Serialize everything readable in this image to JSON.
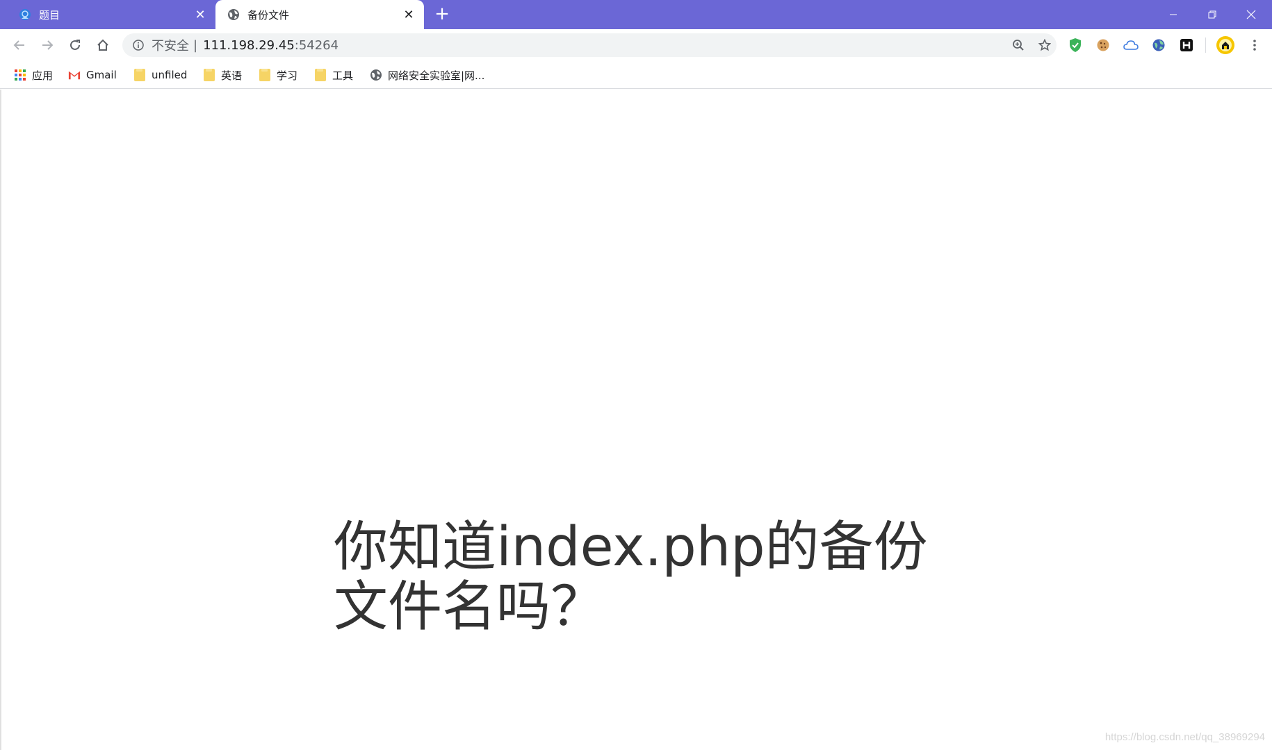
{
  "browser": {
    "tabs": [
      {
        "title": "题目",
        "active": false,
        "favicon": "site-logo-icon"
      },
      {
        "title": "备份文件",
        "active": true,
        "favicon": "globe-icon"
      }
    ],
    "new_tab_label": "+",
    "window_controls": [
      "minimize-icon",
      "restore-icon",
      "close-icon"
    ]
  },
  "toolbar": {
    "security_label": "不安全",
    "separator": "|",
    "url_host": "111.198.29.45",
    "url_port": ":54264",
    "icons": [
      "back-icon",
      "forward-icon",
      "reload-icon",
      "home-icon",
      "zoom-icon",
      "star-icon",
      "menu-icon"
    ],
    "extensions": [
      "shield-extension-icon",
      "cookie-extension-icon",
      "cloud-extension-icon",
      "globe-extension-icon",
      "h-extension-icon",
      "profile-avatar-icon"
    ]
  },
  "bookmarks": [
    {
      "label": "应用",
      "icon": "apps-grid-icon"
    },
    {
      "label": "Gmail",
      "icon": "gmail-icon"
    },
    {
      "label": "unfiled",
      "icon": "folder-icon"
    },
    {
      "label": "英语",
      "icon": "folder-icon"
    },
    {
      "label": "学习",
      "icon": "folder-icon"
    },
    {
      "label": "工具",
      "icon": "folder-icon"
    },
    {
      "label": "网络安全实验室|网...",
      "icon": "globe-icon"
    }
  ],
  "page": {
    "question": "你知道index.php的备份文件名吗？"
  },
  "watermark": "https://blog.csdn.net/qq_38969294",
  "colors": {
    "tabstrip": "#6b67d6",
    "omnibox": "#f1f3f4",
    "text": "#333333",
    "shield_green": "#3bb35a",
    "avatar_yellow": "#f6c600"
  }
}
